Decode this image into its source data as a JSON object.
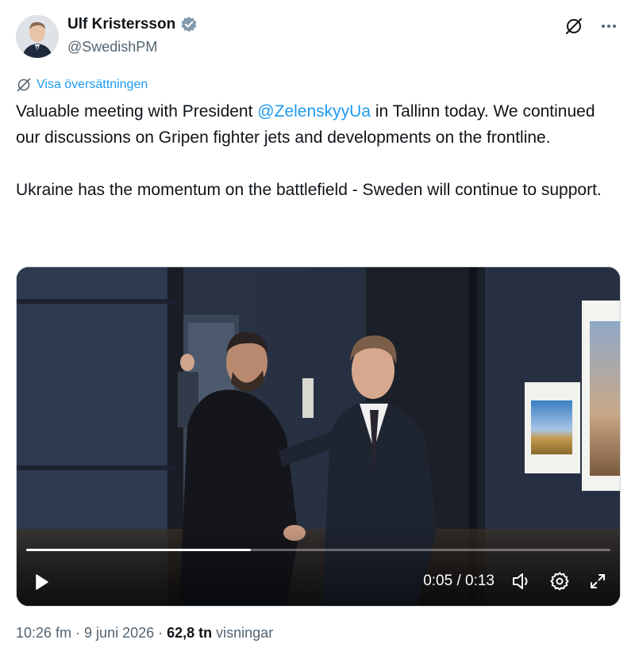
{
  "author": {
    "display_name": "Ulf Kristersson",
    "handle": "@SwedishPM",
    "verified": true
  },
  "actions": {
    "translate_icon": "no-translate-icon",
    "more_icon": "more-icon"
  },
  "translate_link": "Visa översättningen",
  "tweet": {
    "p1_before": "Valuable meeting with President ",
    "mention": "@ZelenskyyUa",
    "p1_after": " in Tallinn today. We continued our discussions on Gripen fighter jets and developments on the frontline.",
    "p2": "Ukraine has the momentum on the battlefield - Sweden will continue to support."
  },
  "video": {
    "time": "0:05 / 0:13",
    "progress": 0.385,
    "icons": [
      "play-icon",
      "volume-icon",
      "settings-icon",
      "fullscreen-icon"
    ]
  },
  "meta": {
    "time": "10:26 fm",
    "separator": "·",
    "date": "9 juni 2026",
    "views_count": "62,8 tn",
    "views_label": "visningar"
  },
  "colors": {
    "accent": "#1d9bf0",
    "secondary_text": "#536471",
    "primary_text": "#0f1419"
  }
}
